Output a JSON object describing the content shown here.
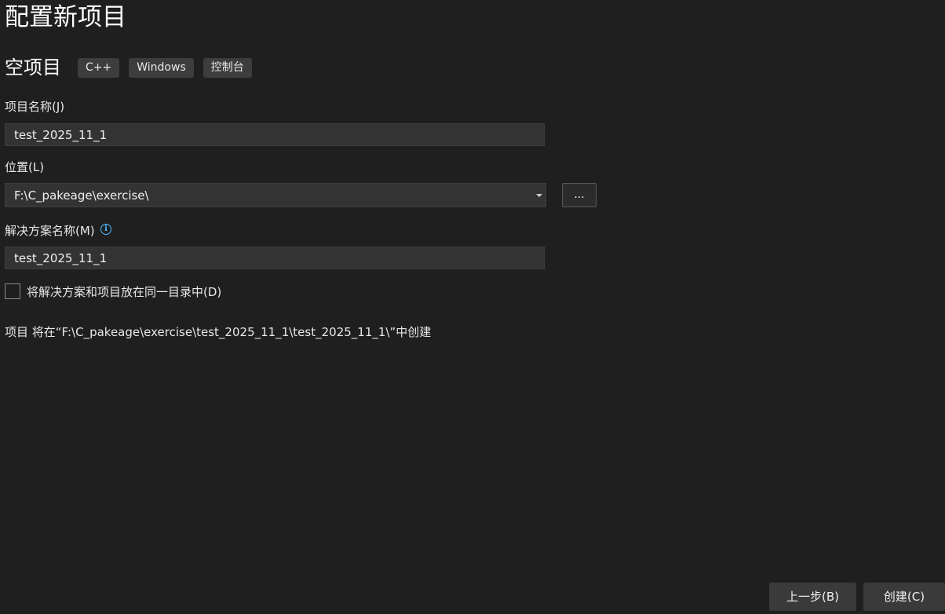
{
  "header": {
    "title": "配置新项目"
  },
  "template": {
    "name": "空项目",
    "tags": [
      "C++",
      "Windows",
      "控制台"
    ]
  },
  "form": {
    "project_name": {
      "label": "项目名称(J)",
      "value": "test_2025_11_1"
    },
    "location": {
      "label": "位置(L)",
      "value": "F:\\C_pakeage\\exercise\\",
      "browse_label": "..."
    },
    "solution_name": {
      "label": "解决方案名称(M)",
      "value": "test_2025_11_1",
      "info_icon": "info-icon",
      "info_glyph": "i"
    },
    "same_directory": {
      "label": "将解决方案和项目放在同一目录中(D)",
      "checked": false
    },
    "summary": "项目 将在“F:\\C_pakeage\\exercise\\test_2025_11_1\\test_2025_11_1\\”中创建"
  },
  "footer": {
    "back_label": "上一步(B)",
    "create_label": "创建(C)"
  },
  "colors": {
    "background": "#1f1f1f",
    "input_background": "#333333",
    "tag_background": "#3d3d3d",
    "button_background": "#3a3a3a",
    "info_accent": "#4fb7ff"
  }
}
